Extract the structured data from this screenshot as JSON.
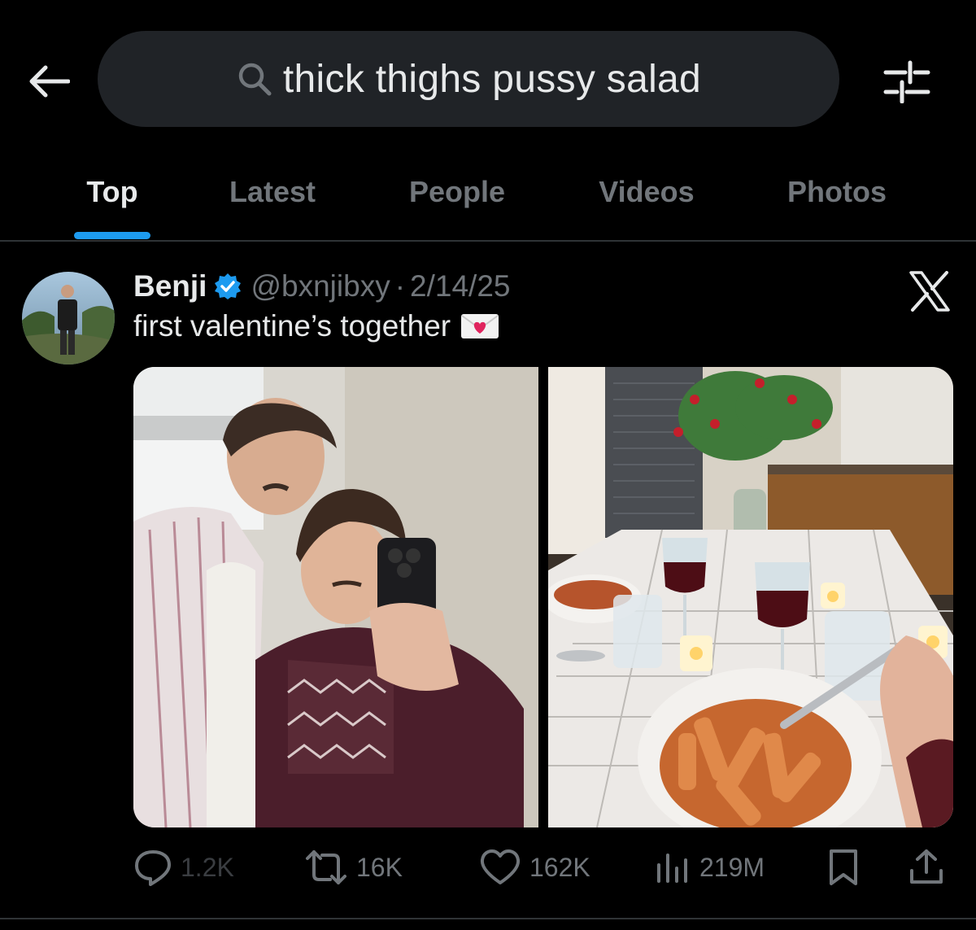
{
  "search": {
    "query": "thick thighs pussy salad",
    "icon": "search-icon"
  },
  "nav": {
    "back_icon": "back-arrow-icon",
    "filter_icon": "sliders-icon"
  },
  "tabs": [
    {
      "label": "Top",
      "active": true
    },
    {
      "label": "Latest",
      "active": false
    },
    {
      "label": "People",
      "active": false
    },
    {
      "label": "Videos",
      "active": false
    },
    {
      "label": "Photos",
      "active": false
    }
  ],
  "tweet": {
    "author": {
      "name": "Benji",
      "handle": "@bxnjibxy",
      "verified": true
    },
    "separator": "·",
    "date": "2/14/25",
    "text": "first valentine’s together",
    "emoji_icon": "love-letter-icon",
    "source_logo": "x-logo-icon",
    "media_count": 2,
    "actions": {
      "replies": "1.2K",
      "reposts": "16K",
      "likes": "162K",
      "views": "219M"
    }
  },
  "colors": {
    "background": "#000000",
    "search_bg": "#202327",
    "accent": "#1d9bf0",
    "text_primary": "#e7e9ea",
    "text_secondary": "#71767b",
    "divider": "#2f3336"
  }
}
